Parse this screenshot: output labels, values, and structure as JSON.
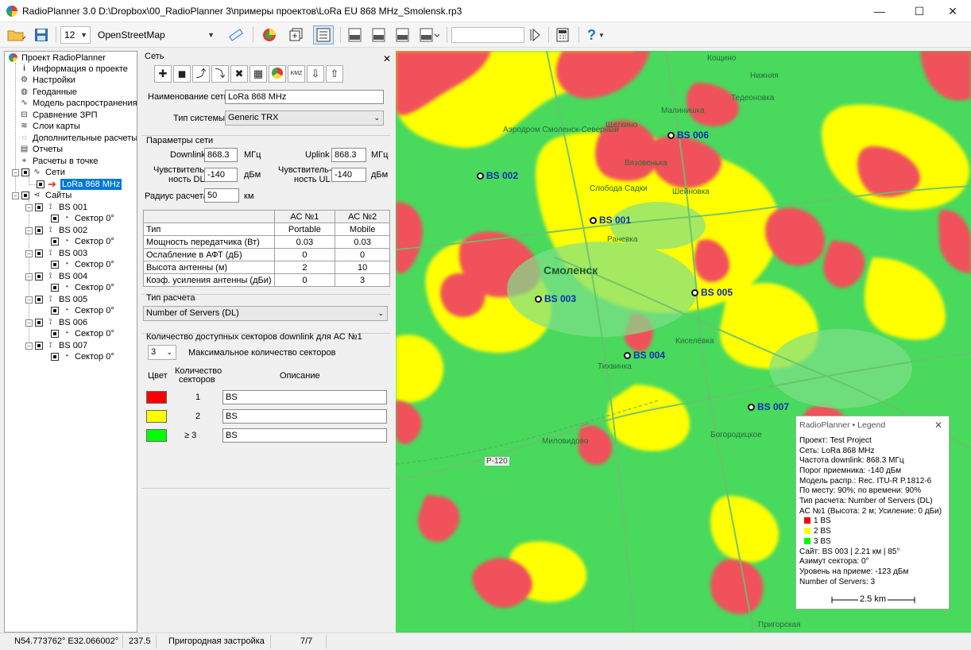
{
  "window": {
    "title": "RadioPlanner 3.0 D:\\Dropbox\\00_RadioPlanner 3\\примеры проектов\\LoRa EU 868 MHz_Smolensk.rp3",
    "minimize": "—",
    "maximize": "☐",
    "close": "✕"
  },
  "toolbar": {
    "font_size": "12",
    "map_source": "OpenStreetMap",
    "search_value": ""
  },
  "tree": {
    "items": [
      {
        "label": "Проект RadioPlanner"
      },
      {
        "label": "Информация о проекте"
      },
      {
        "label": "Настройки"
      },
      {
        "label": "Геоданные"
      },
      {
        "label": "Модель распространения"
      },
      {
        "label": "Сравнение ЗРП"
      },
      {
        "label": "Слои карты"
      },
      {
        "label": "Дополнительные расчеты"
      },
      {
        "label": "Отчеты"
      },
      {
        "label": "Расчеты в точке"
      },
      {
        "label": "Сети"
      },
      {
        "label": "LoRa 868 MHz"
      },
      {
        "label": "Сайты"
      }
    ],
    "sites": [
      {
        "label": "BS 001",
        "sector": "Сектор 0°"
      },
      {
        "label": "BS 002",
        "sector": "Сектор 0°"
      },
      {
        "label": "BS 003",
        "sector": "Сектор 0°"
      },
      {
        "label": "BS 004",
        "sector": "Сектор 0°"
      },
      {
        "label": "BS 005",
        "sector": "Сектор 0°"
      },
      {
        "label": "BS 006",
        "sector": "Сектор 0°"
      },
      {
        "label": "BS 007",
        "sector": "Сектор 0°"
      }
    ]
  },
  "panel": {
    "title": "Сеть",
    "close": "✕",
    "network_name_label": "Наименование сети",
    "network_name": "LoRa 868 MHz",
    "system_type_label": "Тип системы",
    "system_type": "Generic TRX",
    "params_title": "Параметры сети",
    "downlink_label": "Downlink",
    "downlink": "868.3",
    "uplink_label": "Uplink",
    "uplink": "868.3",
    "mhz": "МГц",
    "sens_dl_label_1": "Чувствитель-",
    "sens_dl_label_2": "ность DL",
    "sens_dl": "-140",
    "sens_ul_label_1": "Чувствитель-",
    "sens_ul_label_2": "ность UL",
    "sens_ul": "-140",
    "dbm": "дБм",
    "radius_label": "Радиус расчета",
    "radius": "50",
    "km": "км",
    "table": {
      "headers": [
        "",
        "АС №1",
        "АС №2"
      ],
      "rows": [
        [
          "Тип",
          "Portable",
          "Mobile"
        ],
        [
          "Мощность передатчика (Вт)",
          "0.03",
          "0.03"
        ],
        [
          "Ослабление в АФТ (дБ)",
          "0",
          "0"
        ],
        [
          "Высота антенны (м)",
          "2",
          "10"
        ],
        [
          "Коэф. усиления антенны (дБи)",
          "0",
          "3"
        ]
      ]
    },
    "calc_type_title": "Тип расчета",
    "calc_type": "Number of Servers (DL)",
    "sectors_title": "Количество доступных секторов downlink для АС №1",
    "max_sectors": "3",
    "max_sectors_label": "Максимальное количество секторов",
    "col_color": "Цвет",
    "col_count_1": "Количество",
    "col_count_2": "секторов",
    "col_desc": "Описание",
    "levels": [
      {
        "count": "1",
        "color": "#ff0000",
        "desc": "BS"
      },
      {
        "count": "2",
        "color": "#ffff00",
        "desc": "BS"
      },
      {
        "count": "≥  3",
        "color": "#00ff00",
        "desc": "BS"
      }
    ]
  },
  "map": {
    "sites": [
      "BS 006",
      "BS 002",
      "BS 001",
      "BS 003",
      "BS 005",
      "BS 004",
      "BS 007"
    ],
    "places": [
      "Аэродром Смоленск-Северный",
      "Смоленск",
      "Щеткино",
      "Вязовенька",
      "Слобода Садки",
      "Шейновка",
      "Раневка",
      "Киселёвка",
      "Тихвинка",
      "Миловидово",
      "Р-120",
      "Богородицкое",
      "Тедеоновка",
      "Пригорская",
      "Малинишка",
      "Кощино",
      "Нижняя"
    ],
    "colors": {
      "one": "#ff0000",
      "two": "#ffff00",
      "three": "#00ff00"
    }
  },
  "legend": {
    "title": "RadioPlanner • Legend",
    "close": "✕",
    "lines": [
      "Проект: Test Project",
      "Сеть: LoRa 868 MHz",
      "Частота downlink: 868.3 МГц",
      "Порог приемника: -140 дБм",
      "Модель распр.: Rec. ITU-R P.1812-6",
      "По месту: 90%; по времени: 90%",
      "Тип расчета: Number of Servers (DL)",
      "АС №1 (Высота: 2 м; Усиление: 0 дБи)"
    ],
    "items": [
      {
        "label": "1  BS",
        "color": "#ff0000"
      },
      {
        "label": "2  BS",
        "color": "#ffff00"
      },
      {
        "label": "3  BS",
        "color": "#00ff00"
      }
    ],
    "site_lines": [
      "Сайт: BS 003 | 2.21 км | 85°",
      "Азимут сектора: 0°",
      "Уровень на приеме: -123 дБм",
      "Number of Servers: 3"
    ],
    "scale": "2.5 km"
  },
  "status": {
    "coords": "N54.773762°  E32.066002°",
    "elevation": "237.5",
    "clutter": "Пригородная застройка",
    "page": "7/7"
  }
}
